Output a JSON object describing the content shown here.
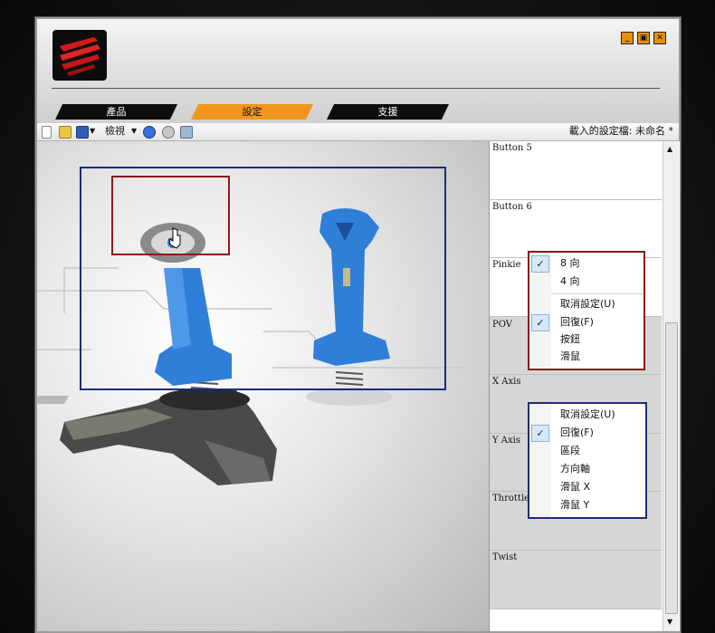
{
  "window": {
    "controls": [
      "_",
      "▣",
      "✕"
    ]
  },
  "tabs": [
    {
      "label": "產品",
      "active": false
    },
    {
      "label": "設定",
      "active": true
    },
    {
      "label": "支援",
      "active": false
    }
  ],
  "toolbar": {
    "view_label": "檢視",
    "profile_label": "載入的設定檔: 未命名 *"
  },
  "panel": {
    "rows": [
      {
        "label": "Button 5"
      },
      {
        "label": "Button 6"
      },
      {
        "label": "Pinkie"
      },
      {
        "label": "POV"
      },
      {
        "label": "X Axis"
      },
      {
        "label": "Y Axis"
      },
      {
        "label": "Throttle"
      },
      {
        "label": "Twist"
      }
    ]
  },
  "menu_pov": {
    "items": [
      {
        "label": "8 向",
        "checked": true
      },
      {
        "label": "4 向",
        "checked": false
      },
      {
        "label": "取消設定(U)",
        "checked": false
      },
      {
        "label": "回復(F)",
        "checked": true
      },
      {
        "label": "按鈕",
        "checked": false
      },
      {
        "label": "滑鼠",
        "checked": false
      }
    ]
  },
  "menu_axis": {
    "items": [
      {
        "label": "取消設定(U)",
        "checked": false
      },
      {
        "label": "回復(F)",
        "checked": true
      },
      {
        "label": "區段",
        "checked": false
      },
      {
        "label": "方向軸",
        "checked": false
      },
      {
        "label": "滑鼠 X",
        "checked": false
      },
      {
        "label": "滑鼠 Y",
        "checked": false
      }
    ]
  },
  "colors": {
    "accent": "#f0961c",
    "highlight_red": "#8b1a1a",
    "highlight_blue": "#1a2d7a",
    "joystick_blue": "#2f7fd8"
  }
}
